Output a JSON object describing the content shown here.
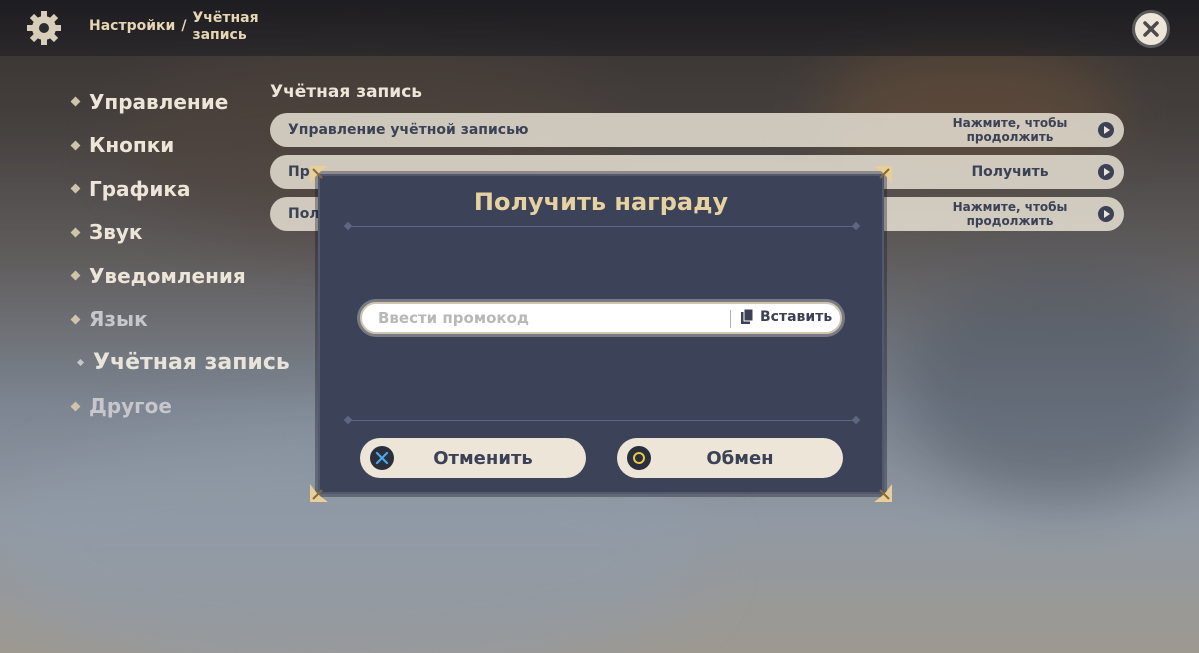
{
  "header": {
    "crumb_root": "Настройки",
    "crumb_sep": "/",
    "crumb_current": "Учётная запись"
  },
  "sidebar": {
    "items": [
      {
        "label": "Управление"
      },
      {
        "label": "Кнопки"
      },
      {
        "label": "Графика"
      },
      {
        "label": "Звук"
      },
      {
        "label": "Уведомления"
      },
      {
        "label": "Язык"
      },
      {
        "label": "Учётная запись"
      },
      {
        "label": "Другое"
      }
    ]
  },
  "main": {
    "section_title": "Учётная запись",
    "rows": [
      {
        "label": "Управление учётной записью",
        "action": "Нажмите, чтобы продолжить"
      },
      {
        "label": "Пр",
        "action": "Получить"
      },
      {
        "label": "Пол",
        "action": "Нажмите, чтобы продолжить"
      }
    ]
  },
  "modal": {
    "title": "Получить награду",
    "input_placeholder": "Ввести промокод",
    "paste_label": "Вставить",
    "cancel_label": "Отменить",
    "confirm_label": "Обмен"
  },
  "colors": {
    "accent_gold": "#e6d2a0",
    "modal_bg": "#3c4258",
    "button_bg": "#ece5d8",
    "cancel_icon": "#4aa8e8",
    "confirm_icon": "#e8c848"
  }
}
